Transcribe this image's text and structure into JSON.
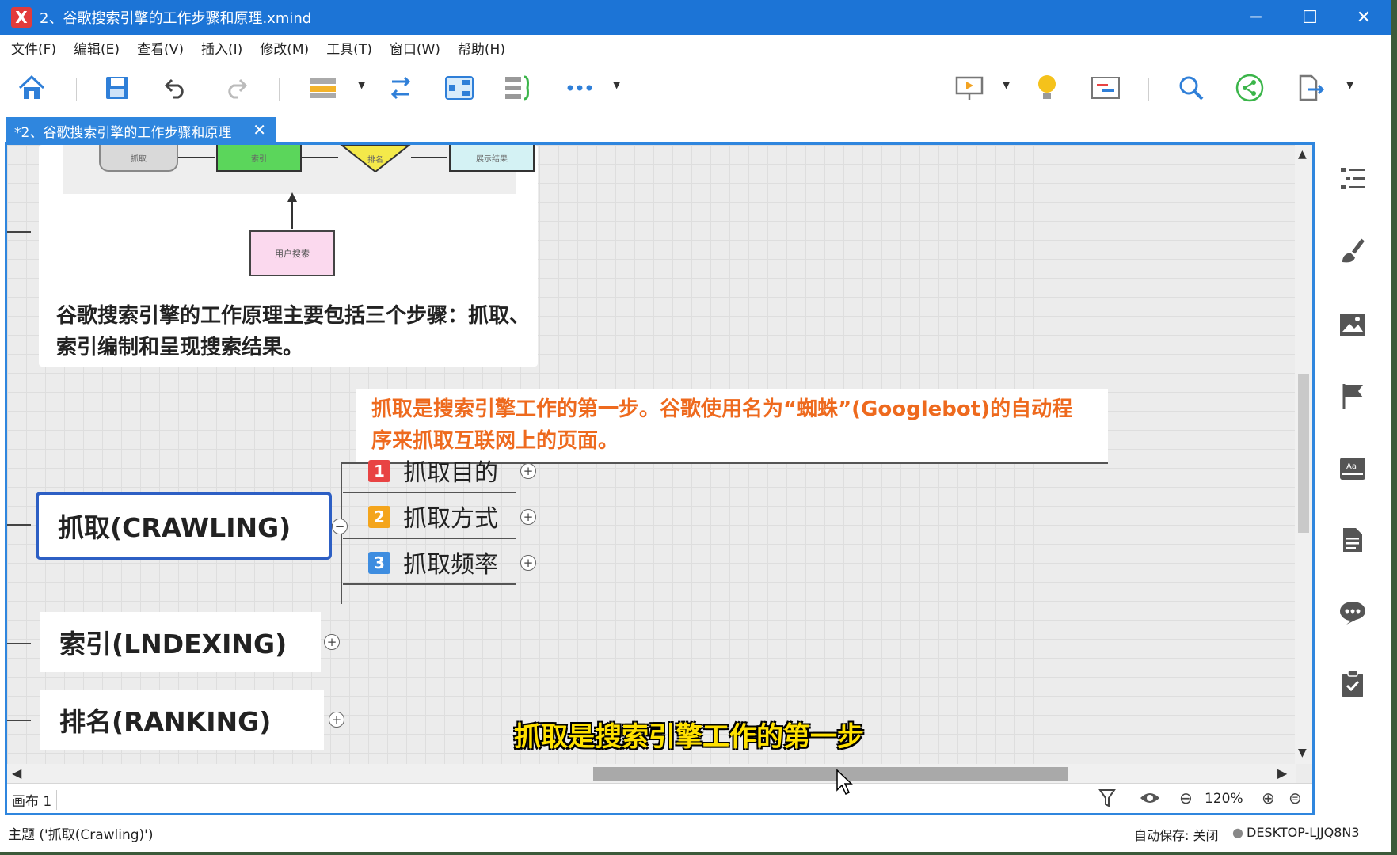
{
  "window": {
    "title": "2、谷歌搜索引擎的工作步骤和原理.xmind",
    "logo": "X"
  },
  "menu": {
    "file": "文件(F)",
    "edit": "编辑(E)",
    "view": "查看(V)",
    "insert": "插入(I)",
    "modify": "修改(M)",
    "tools": "工具(T)",
    "window": "窗口(W)",
    "help": "帮助(H)"
  },
  "tab": {
    "label": "*2、谷歌搜索引擎的工作步骤和原理"
  },
  "image_node": {
    "flow_labels": [
      "抓取",
      "索引",
      "排名",
      "展示结果"
    ],
    "user_search": "用户搜索",
    "description": "谷歌搜索引擎的工作原理主要包括三个步骤：抓取、索引编制和呈现搜索结果。"
  },
  "callout": {
    "text": "抓取是搜索引擎工作的第一步。谷歌使用名为“蜘蛛”(Googlebot)的自动程序来抓取互联网上的页面。"
  },
  "topics": {
    "crawling": "抓取(CRAWLING)",
    "indexing": "索引(LNDEXING)",
    "ranking": "排名(RANKING)"
  },
  "subtopics": [
    {
      "num": "1",
      "label": "抓取目的",
      "color": "#e84343"
    },
    {
      "num": "2",
      "label": "抓取方式",
      "color": "#f4a51c"
    },
    {
      "num": "3",
      "label": "抓取频率",
      "color": "#3e8de0"
    }
  ],
  "subtitle": "抓取是搜索引擎工作的第一步",
  "canvas_status": {
    "sheet": "画布 1",
    "zoom": "120%"
  },
  "status": {
    "topic": "主题 ('抓取(Crawling)')",
    "autosave": "自动保存: 关闭",
    "computer": "DESKTOP-LJJQ8N3"
  },
  "colors": {
    "titlebar": "#1c74d6",
    "accent": "#2d5fc4",
    "callout_text": "#ee6a1e",
    "subtitle": "#ffe100"
  }
}
